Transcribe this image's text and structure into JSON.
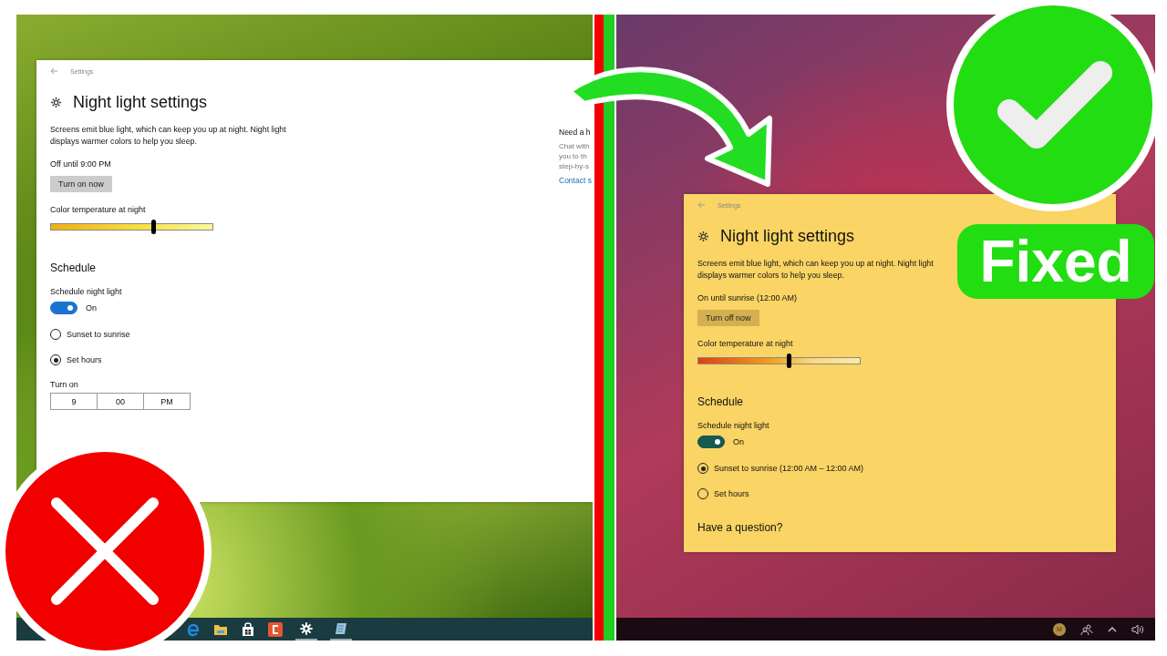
{
  "screens": [
    {
      "night_light": false,
      "window": {
        "nav_title": "Settings",
        "title": "Night light settings",
        "description": "Screens emit blue light, which can keep you up at night. Night light displays warmer colors to help you sleep.",
        "status": "Off until 9:00 PM",
        "action_button": "Turn on now",
        "slider_label": "Color temperature at night",
        "level": 0.63,
        "schedule_heading": "Schedule",
        "schedule_label": "Schedule night light",
        "schedule_on": true,
        "toggle_text": "On",
        "options": [
          {
            "label": "Sunset to sunrise",
            "selected": false
          },
          {
            "label": "Set hours",
            "selected": true
          }
        ],
        "turn_on_label": "Turn on",
        "turn_on_time": [
          "9",
          "00",
          "PM"
        ]
      },
      "help": {
        "heading": "Need a h",
        "lines": [
          "Chat with",
          "you to th",
          "step-by-s"
        ],
        "link": "Contact s"
      },
      "taskbar": {
        "kind": "apps"
      }
    },
    {
      "night_light": true,
      "window": {
        "nav_title": "Settings",
        "title": "Night light settings",
        "description": "Screens emit blue light, which can keep you up at night. Night light displays warmer colors to help you sleep.",
        "status": "On until sunrise (12:00 AM)",
        "action_button": "Turn off now",
        "slider_label": "Color temperature at night",
        "level": 0.56,
        "schedule_heading": "Schedule",
        "schedule_label": "Schedule night light",
        "schedule_on": true,
        "toggle_text": "On",
        "options": [
          {
            "label": "Sunset to sunrise (12:00 AM – 12:00 AM)",
            "selected": true
          },
          {
            "label": "Set hours",
            "selected": false
          }
        ],
        "question": "Have a question?"
      },
      "taskbar": {
        "kind": "tray",
        "avatar": "M"
      }
    }
  ],
  "badge": "Fixed"
}
